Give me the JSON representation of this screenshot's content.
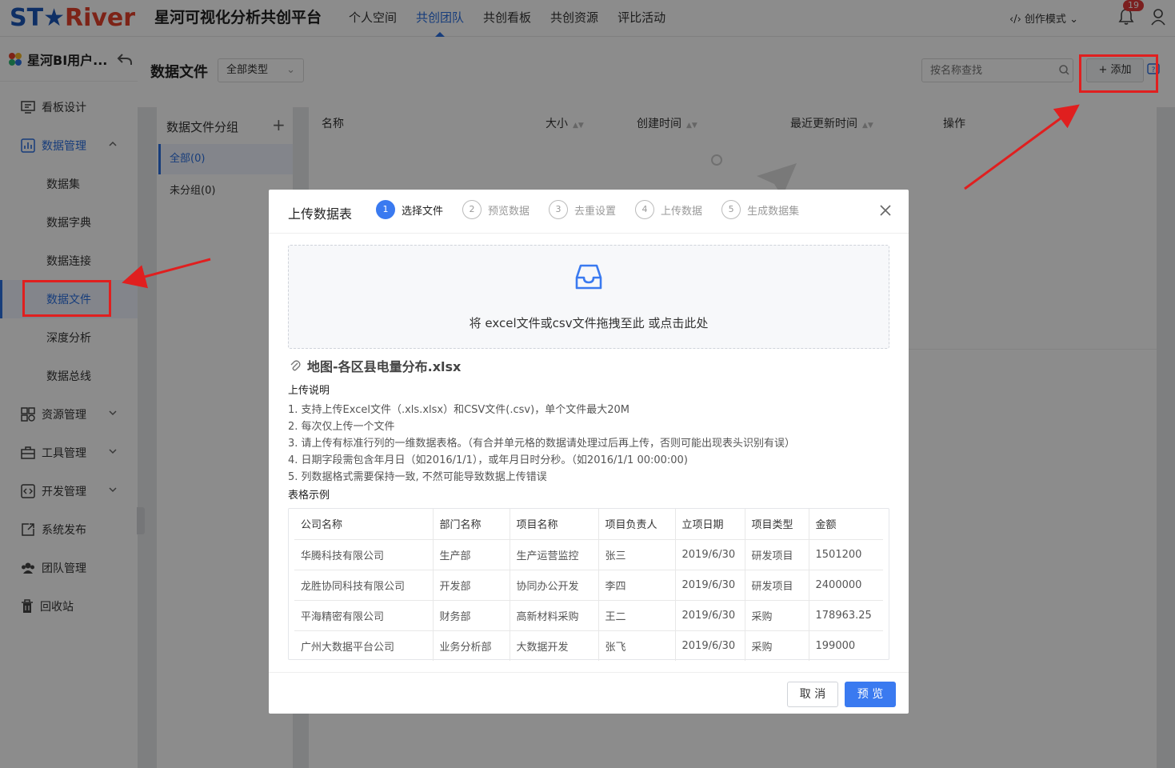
{
  "brand": {
    "logo_part1": "ST",
    "logo_star": "★",
    "logo_part2": "River",
    "platform_title": "星河可视化分析共创平台"
  },
  "nav": {
    "items": [
      "个人空间",
      "共创团队",
      "共创看板",
      "共创资源",
      "评比活动"
    ],
    "active": "共创团队"
  },
  "header_right": {
    "mode_label": "‹/› 创作模式",
    "notification_count": "19"
  },
  "sidebar": {
    "team_name": "星河BI用户...",
    "menu": [
      {
        "label": "看板设计",
        "icon": "dashboard-icon"
      },
      {
        "label": "数据管理",
        "icon": "data-icon",
        "open": true
      },
      {
        "label": "资源管理",
        "icon": "resource-icon"
      },
      {
        "label": "工具管理",
        "icon": "tool-icon"
      },
      {
        "label": "开发管理",
        "icon": "code-icon"
      },
      {
        "label": "系统发布",
        "icon": "publish-icon"
      },
      {
        "label": "团队管理",
        "icon": "team-icon"
      },
      {
        "label": "回收站",
        "icon": "trash-icon"
      }
    ],
    "submenu": [
      "数据集",
      "数据字典",
      "数据连接",
      "数据文件",
      "深度分析",
      "数据总线"
    ],
    "active_submenu": "数据文件"
  },
  "content": {
    "page_title": "数据文件",
    "type_filter": "全部类型",
    "search_placeholder": "按名称查找",
    "add_label": "+ 添加",
    "group_panel": {
      "title": "数据文件分组",
      "items": [
        "全部(0)",
        "未分组(0)"
      ]
    },
    "table_headers": [
      "名称",
      "大小",
      "创建时间",
      "最近更新时间",
      "操作"
    ]
  },
  "modal": {
    "title": "上传数据表",
    "steps": [
      {
        "num": "1",
        "label": "选择文件"
      },
      {
        "num": "2",
        "label": "预览数据"
      },
      {
        "num": "3",
        "label": "去重设置"
      },
      {
        "num": "4",
        "label": "上传数据"
      },
      {
        "num": "5",
        "label": "生成数据集"
      }
    ],
    "active_step": 1,
    "drop_text": "将 excel文件或csv文件拖拽至此 或点击此处",
    "file_name": "地图-各区县电量分布.xlsx",
    "desc_title": "上传说明",
    "desc_lines": [
      "1. 支持上传Excel文件（.xls.xlsx）和CSV文件(.csv)，单个文件最大20M",
      "2. 每次仅上传一个文件",
      "3. 请上传有标准行列的一维数据表格。（有合并单元格的数据请处理过后再上传，否则可能出现表头识别有误）",
      "4. 日期字段需包含年月日（如2016/1/1），或年月日时分秒。（如2016/1/1 00:00:00)",
      "5. 列数据格式需要保持一致, 不然可能导致数据上传错误"
    ],
    "sample_title": "表格示例",
    "sample_headers": [
      "公司名称",
      "部门名称",
      "项目名称",
      "项目负责人",
      "立项日期",
      "项目类型",
      "金额"
    ],
    "sample_rows": [
      [
        "华腾科技有限公司",
        "生产部",
        "生产运营监控",
        "张三",
        "2019/6/30",
        "研发项目",
        "1501200"
      ],
      [
        "龙胜协同科技有限公司",
        "开发部",
        "协同办公开发",
        "李四",
        "2019/6/30",
        "研发项目",
        "2400000"
      ],
      [
        "平海精密有限公司",
        "财务部",
        "高新材料采购",
        "王二",
        "2019/6/30",
        "采购",
        "178963.25"
      ],
      [
        "广州大数据平台公司",
        "业务分析部",
        "大数据开发",
        "张飞",
        "2019/6/30",
        "采购",
        "199000"
      ]
    ],
    "cancel_label": "取 消",
    "preview_label": "预 览"
  },
  "colors": {
    "accent": "#3a7af0",
    "annotation": "#e01f1f"
  }
}
